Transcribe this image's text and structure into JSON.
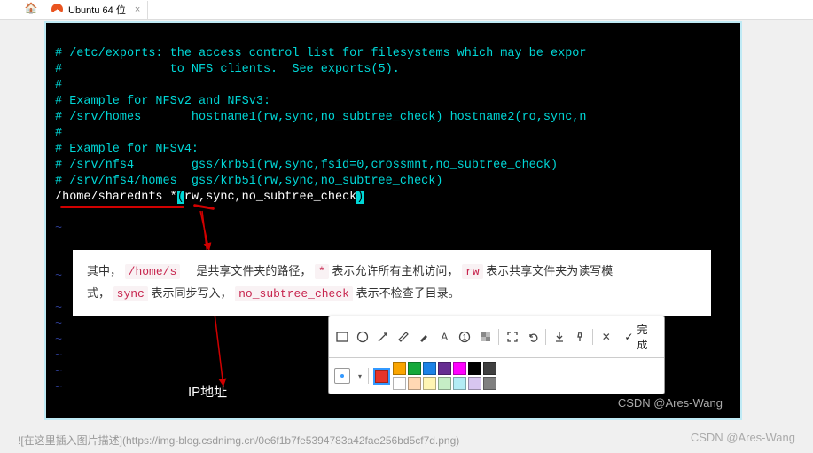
{
  "tabs": {
    "home_icon": "🏠",
    "items": [
      {
        "label": "Ubuntu 64 位",
        "close": "×"
      }
    ]
  },
  "terminal": {
    "lines": [
      "# /etc/exports: the access control list for filesystems which may be expor",
      "#               to NFS clients.  See exports(5).",
      "#",
      "# Example for NFSv2 and NFSv3:",
      "# /srv/homes       hostname1(rw,sync,no_subtree_check) hostname2(ro,sync,n",
      "#",
      "# Example for NFSv4:",
      "# /srv/nfs4        gss/krb5i(rw,sync,fsid=0,crossmnt,no_subtree_check)",
      "# /srv/nfs4/homes  gss/krb5i(rw,sync,no_subtree_check)"
    ],
    "last_line_prefix": "/home/sharednfs *",
    "last_line_open": "(",
    "last_line_mid": "rw,sync,no_subtree_check",
    "last_line_close": ")"
  },
  "annotation": {
    "t1": "其中，",
    "code_path": "/home/s",
    "t2": "是共享文件夹的路径，",
    "code_star": "*",
    "t3": "表示允许所有主机访问，",
    "code_rw": "rw",
    "t4": "表示共享文件夹为读写模",
    "t5": "式，",
    "code_sync": "sync",
    "t6": "表示同步写入，",
    "code_nsc": "no_subtree_check",
    "t7": "表示不检查子目录。"
  },
  "ip_label": "IP地址",
  "toolbar": {
    "buttons": [
      "rect",
      "circle",
      "arrow",
      "pen",
      "marker",
      "text",
      "num",
      "blur",
      "expand",
      "undo",
      "download",
      "pin",
      "close"
    ],
    "done_label": "完成",
    "colors_row1": [
      "#e53329",
      "#faa500",
      "#15a83b",
      "#1b82e6",
      "#662d91",
      "#000000",
      "#404040"
    ],
    "colors_row2": [
      "#ffffff",
      "#ffd8d8",
      "#ffe9b3",
      "#c6eec6",
      "#b3d8f5",
      "#d8c6f0",
      "#808080"
    ]
  },
  "watermark_inner": "CSDN @Ares-Wang",
  "watermark_outer": "CSDN @Ares-Wang",
  "caption": "![在这里插入图片描述](https://img-blog.csdnimg.cn/0e6f1b7fe5394783a42fae256bd5cf7d.png)"
}
